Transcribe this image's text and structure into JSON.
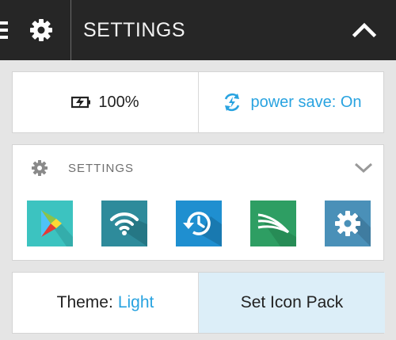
{
  "header": {
    "title": "SETTINGS",
    "menu_icon": "hamburger-menu-icon",
    "gear_icon": "gear-icon",
    "collapse_icon": "chevron-up-icon"
  },
  "status": {
    "battery_icon": "battery-charging-icon",
    "battery_level": "100%",
    "power_save_icon": "power-save-sync-icon",
    "power_save_label": "power save: On"
  },
  "settings_panel": {
    "label": "SETTINGS",
    "apps": [
      {
        "name": "Play Store",
        "icon": "play-store-icon"
      },
      {
        "name": "Wi-Fi",
        "icon": "wifi-icon"
      },
      {
        "name": "Backup",
        "icon": "backup-restore-icon"
      },
      {
        "name": "SwiftKey",
        "icon": "swiftkey-icon"
      },
      {
        "name": "Settings",
        "icon": "settings-gear-icon"
      }
    ]
  },
  "theme": {
    "label": "Theme:",
    "value": "Light",
    "icon_pack_label": "Set Icon Pack"
  },
  "colors": {
    "header_bg": "#262626",
    "accent": "#29a3e0",
    "page_bg": "#e5e5e5",
    "icon_pack_bg": "#dceef8"
  }
}
